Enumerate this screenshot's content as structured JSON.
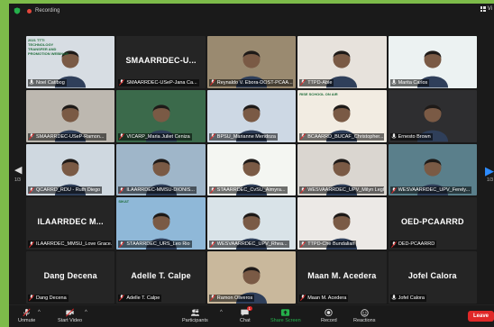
{
  "topbar": {
    "recording_label": "Recording",
    "view_label": "Vi"
  },
  "gallery": {
    "page_indicator_left": "1/3",
    "page_indicator_right": "1/3",
    "tiles": [
      {
        "name": "Noel Catibog",
        "muted": false,
        "type": "video",
        "bg": "#d7dde3",
        "banner": "2021 TTTI TECHNOLOGY TRANSFER AND PROMOTION WEBINAR"
      },
      {
        "name": "SMAARRDEC-USeP-Jana Ca...",
        "muted": true,
        "type": "name",
        "big": "SMAARRDEC-U..."
      },
      {
        "name": "Reynaldo V. Ebora-DOST-PCAA...",
        "muted": true,
        "type": "video",
        "bg": "#9a8a70"
      },
      {
        "name": "TTPD-Abie",
        "muted": true,
        "type": "video",
        "bg": "#e7e2dc"
      },
      {
        "name": "Marita Carlos",
        "muted": false,
        "type": "video",
        "bg": "#ecf2f2",
        "speaking": true
      },
      {
        "name": "SMAARRDEC-USeP-Ramon...",
        "muted": true,
        "type": "video",
        "bg": "#bdb8b0"
      },
      {
        "name": "VICARP_Maria Juliet Ceniza",
        "muted": true,
        "type": "video",
        "bg": "#3b6a4b"
      },
      {
        "name": "BPSU_Marianne Mendoza",
        "muted": true,
        "type": "video",
        "bg": "#cdd8e4"
      },
      {
        "name": "BCAARRD_BUCAF_Christopher...",
        "muted": true,
        "type": "video",
        "bg": "#f2ece2",
        "banner": "RISE SCHOOL ON AIR"
      },
      {
        "name": "Ernesto Brown",
        "muted": false,
        "type": "video",
        "bg": "#2e2e30"
      },
      {
        "name": "QCARRD_RDU - Ruth Diego",
        "muted": true,
        "type": "video",
        "bg": "#cfd8e0"
      },
      {
        "name": "ILAARRDEC-MMSU-DIONIS...",
        "muted": true,
        "type": "video",
        "bg": "#9fb6c9"
      },
      {
        "name": "STAARRDEC_CvSU_Aimyra...",
        "muted": true,
        "type": "video",
        "bg": "#f4f6f2"
      },
      {
        "name": "WESVAARRDEC_UPV_Milyn Legh...",
        "muted": true,
        "type": "video",
        "bg": "#dad6d0"
      },
      {
        "name": "WESVAARRDEC_UPV_Ferely...",
        "muted": true,
        "type": "video",
        "bg": "#5a7f8b"
      },
      {
        "name": "ILAARRDEC_MMSU_Love Grace...",
        "muted": true,
        "type": "name",
        "big": "ILAARRDEC  M..."
      },
      {
        "name": "STAARRDEC_URS_Leo Rio",
        "muted": true,
        "type": "video",
        "bg": "#8fb8d8",
        "banner": "SIKAT"
      },
      {
        "name": "WESVAARRDEC_UPV_Rhea...",
        "muted": true,
        "type": "video",
        "bg": "#d9e3e8"
      },
      {
        "name": "TTPD-Che Bundalian",
        "muted": true,
        "type": "video",
        "bg": "#ece9e6"
      },
      {
        "name": "OED-PCAARRD",
        "muted": true,
        "type": "name",
        "big": "OED-PCAARRD"
      },
      {
        "name": "Dang Decena",
        "muted": true,
        "type": "name",
        "big": "Dang Decena"
      },
      {
        "name": "Adelle T. Calpe",
        "muted": true,
        "type": "name",
        "big": "Adelle T. Calpe"
      },
      {
        "name": "Ramon Oliveros",
        "muted": true,
        "type": "video",
        "bg": "#c9b89c"
      },
      {
        "name": "Maan M. Acedera",
        "muted": true,
        "type": "name",
        "big": "Maan M. Acedera"
      },
      {
        "name": "Jofel Calora",
        "muted": false,
        "type": "name",
        "big": "Jofel Calora"
      }
    ]
  },
  "toolbar": {
    "unmute": "Unmute",
    "start_video": "Start Video",
    "participants": "Participants",
    "participants_count": "63",
    "chat": "Chat",
    "chat_badge": "1",
    "share_screen": "Share Screen",
    "record": "Record",
    "reactions": "Reactions",
    "leave": "Leave"
  },
  "colors": {
    "accent_green": "#25b14b",
    "leave_red": "#e02828",
    "speaking_border": "#33c24a",
    "background": "#7dbb4a"
  }
}
